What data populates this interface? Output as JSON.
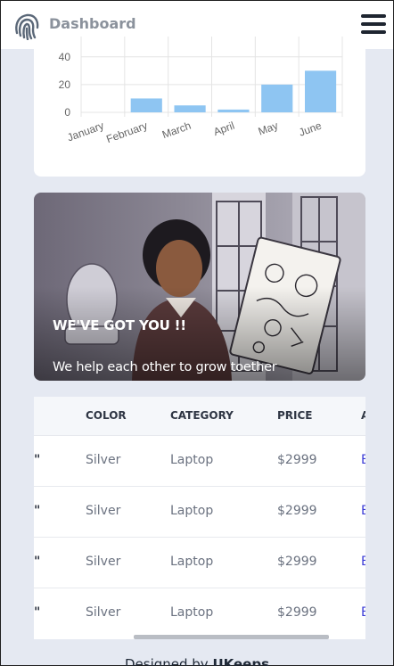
{
  "header": {
    "brand": "Dashboard",
    "logo_icon": "fingerprint-icon",
    "menu_icon": "hamburger-menu-icon"
  },
  "chart_data": {
    "type": "bar",
    "categories": [
      "January",
      "February",
      "March",
      "April",
      "May",
      "June"
    ],
    "values": [
      0,
      10,
      5,
      2,
      20,
      30
    ],
    "yticks": [
      0,
      20,
      40
    ],
    "ylim": [
      0,
      45
    ],
    "bar_color": "#8ec5f2",
    "grid": true
  },
  "hero": {
    "title": "WE'VE GOT YOU !!",
    "subtitle": "We help each other to grow toether"
  },
  "table": {
    "headers": [
      "COLOR",
      "CATEGORY",
      "PRICE",
      "A"
    ],
    "rows": [
      {
        "quote": "\"",
        "color": "Silver",
        "category": "Laptop",
        "price": "$2999",
        "action": "E"
      },
      {
        "quote": "\"",
        "color": "Silver",
        "category": "Laptop",
        "price": "$2999",
        "action": "E"
      },
      {
        "quote": "\"",
        "color": "Silver",
        "category": "Laptop",
        "price": "$2999",
        "action": "E"
      },
      {
        "quote": "\"",
        "color": "Silver",
        "category": "Laptop",
        "price": "$2999",
        "action": "E"
      }
    ]
  },
  "footer": {
    "prefix": "Designed by ",
    "author": "UKeeps"
  },
  "colors": {
    "page_bg": "#e5e9f2",
    "accent": "#3b3bd6",
    "bar": "#8ec5f2"
  }
}
